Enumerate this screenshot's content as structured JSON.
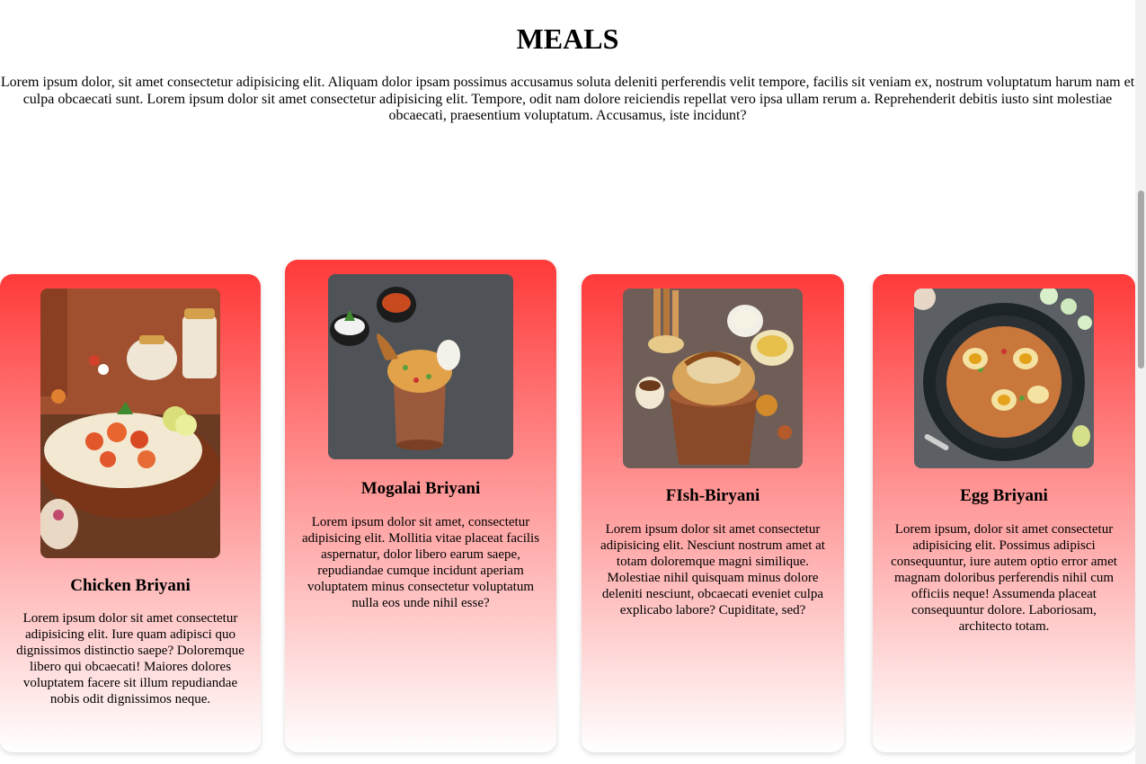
{
  "heading": "MEALS",
  "intro": "Lorem ipsum dolor, sit amet consectetur adipisicing elit. Aliquam dolor ipsam possimus accusamus soluta deleniti perferendis velit tempore, facilis sit veniam ex, nostrum voluptatum harum nam et culpa obcaecati sunt. Lorem ipsum dolor sit amet consectetur adipisicing elit. Tempore, odit nam dolore reiciendis repellat vero ipsa ullam rerum a. Reprehenderit debitis iusto sint molestiae obcaecati, praesentium voluptatum. Accusamus, iste incidunt?",
  "accent_color": "#ff3a3a",
  "cards": [
    {
      "title": "Chicken Briyani",
      "text": "Lorem ipsum dolor sit amet consectetur adipisicing elit. Iure quam adipisci quo dignissimos distinctio saepe? Doloremque libero qui obcaecati! Maiores dolores voluptatem facere sit illum repudiandae nobis odit dignissimos neque."
    },
    {
      "title": "Mogalai Briyani",
      "text": "Lorem ipsum dolor sit amet, consectetur adipisicing elit. Mollitia vitae placeat facilis aspernatur, dolor libero earum saepe, repudiandae cumque incidunt aperiam voluptatem minus consectetur voluptatum nulla eos unde nihil esse?"
    },
    {
      "title": "FIsh-Biryani",
      "text": "Lorem ipsum dolor sit amet consectetur adipisicing elit. Nesciunt nostrum amet at totam doloremque magni similique. Molestiae nihil quisquam minus dolore deleniti nesciunt, obcaecati eveniet culpa explicabo labore? Cupiditate, sed?"
    },
    {
      "title": "Egg Briyani",
      "text": "Lorem ipsum, dolor sit amet consectetur adipisicing elit. Possimus adipisci consequuntur, iure autem optio error amet magnam doloribus perferendis nihil cum officiis neque! Assumenda placeat consequuntur dolore. Laboriosam, architecto totam."
    }
  ]
}
